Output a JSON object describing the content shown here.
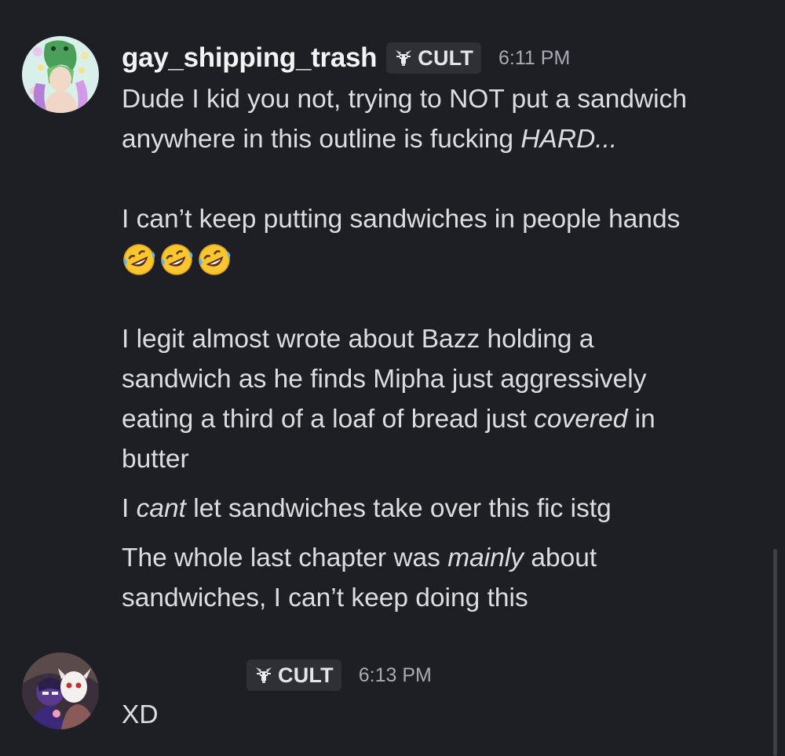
{
  "messages": [
    {
      "username": "gay_shipping_trash",
      "tag": "CULT",
      "timestamp": "6:11 PM",
      "paragraphs": {
        "p1_line1": "Dude I kid you not, trying to NOT put a sandwich",
        "p1_line2a": "anywhere in this outline is fucking ",
        "p1_line2b": "HARD...",
        "p2": "I can’t keep putting sandwiches in people hands",
        "p3_line1": "I legit almost wrote about Bazz holding a",
        "p3_line2": "sandwich as he finds Mipha just aggressively",
        "p3_line3a": "eating a third of a loaf of bread just ",
        "p3_line3b": "covered",
        "p3_line3c": " in",
        "p3_line4": "butter",
        "p4a": "I ",
        "p4b": "cant",
        "p4c": " let sandwiches take over this fic istg",
        "p5_line1a": "The whole last chapter was ",
        "p5_line1b": "mainly",
        "p5_line1c": " about",
        "p5_line2": "sandwiches, I can’t keep doing this"
      },
      "emojis": [
        "rofl-emoji",
        "rofl-emoji",
        "rofl-emoji"
      ]
    },
    {
      "username": "",
      "tag": "CULT",
      "timestamp": "6:13 PM",
      "text": "XD"
    }
  ],
  "colors": {
    "background": "#1e1f24",
    "text": "#dbdee1",
    "username": "#f2f3f5",
    "tag_bg": "#2e3036",
    "timestamp": "#a8abb3"
  }
}
